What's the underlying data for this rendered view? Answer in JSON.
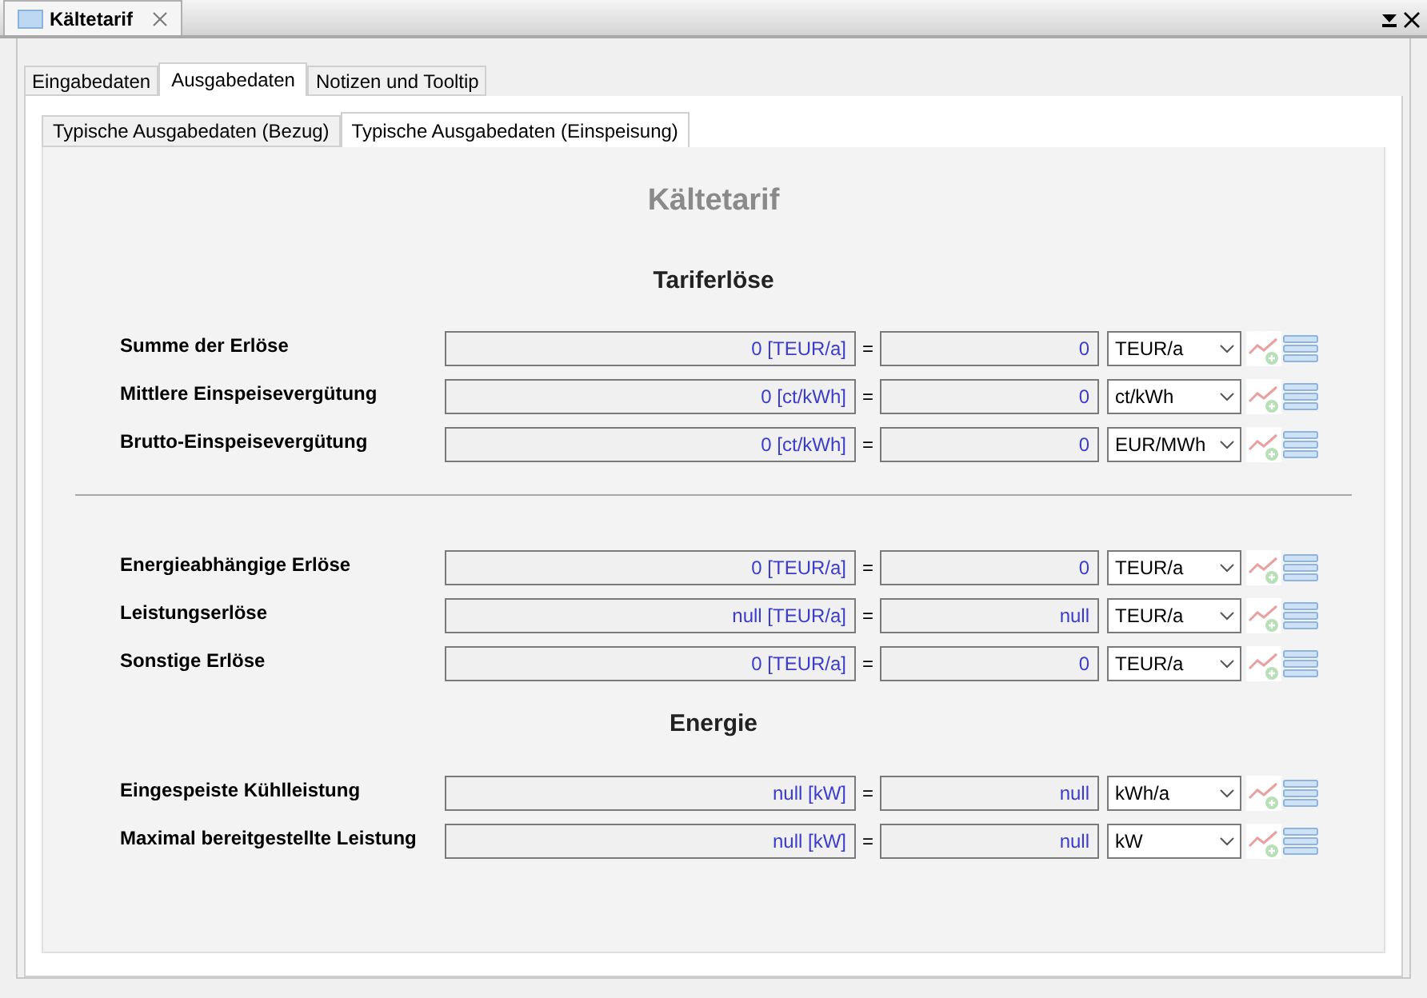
{
  "document_tab": {
    "title": "Kältetarif"
  },
  "tabs": [
    {
      "label": "Eingabedaten",
      "selected": false
    },
    {
      "label": "Ausgabedaten",
      "selected": true
    },
    {
      "label": "Notizen und Tooltip",
      "selected": false
    }
  ],
  "subtabs": [
    {
      "label": "Typische Ausgabedaten (Bezug)",
      "selected": false
    },
    {
      "label": "Typische Ausgabedaten (Einspeisung)",
      "selected": true
    }
  ],
  "heading": "Kältetarif",
  "groups": [
    {
      "kind": "titled",
      "title": "Tariferlöse",
      "rows": [
        {
          "label": "Summe der Erlöse",
          "value": "0 [TEUR/a]",
          "equals": "=",
          "result": "0",
          "unit": "TEUR/a"
        },
        {
          "label": "Mittlere Einspeisevergütung",
          "value": "0 [ct/kWh]",
          "equals": "=",
          "result": "0",
          "unit": "ct/kWh"
        },
        {
          "label": "Brutto-Einspeisevergütung",
          "value": "0 [ct/kWh]",
          "equals": "=",
          "result": "0",
          "unit": "EUR/MWh"
        }
      ]
    },
    {
      "kind": "divided",
      "rows": [
        {
          "label": "Energieabhängige Erlöse",
          "value": "0 [TEUR/a]",
          "equals": "=",
          "result": "0",
          "unit": "TEUR/a"
        },
        {
          "label": "Leistungserlöse",
          "value": "null [TEUR/a]",
          "equals": "=",
          "result": "null",
          "unit": "TEUR/a"
        },
        {
          "label": "Sonstige Erlöse",
          "value": "0 [TEUR/a]",
          "equals": "=",
          "result": "0",
          "unit": "TEUR/a"
        }
      ]
    },
    {
      "kind": "titled",
      "title": "Energie",
      "rows": [
        {
          "label": "Eingespeiste Kühlleistung",
          "value": "null [kW]",
          "equals": "=",
          "result": "null",
          "unit": "kWh/a"
        },
        {
          "label": "Maximal bereitgestellte Leistung",
          "value": "null [kW]",
          "equals": "=",
          "result": "null",
          "unit": "kW"
        }
      ]
    }
  ]
}
